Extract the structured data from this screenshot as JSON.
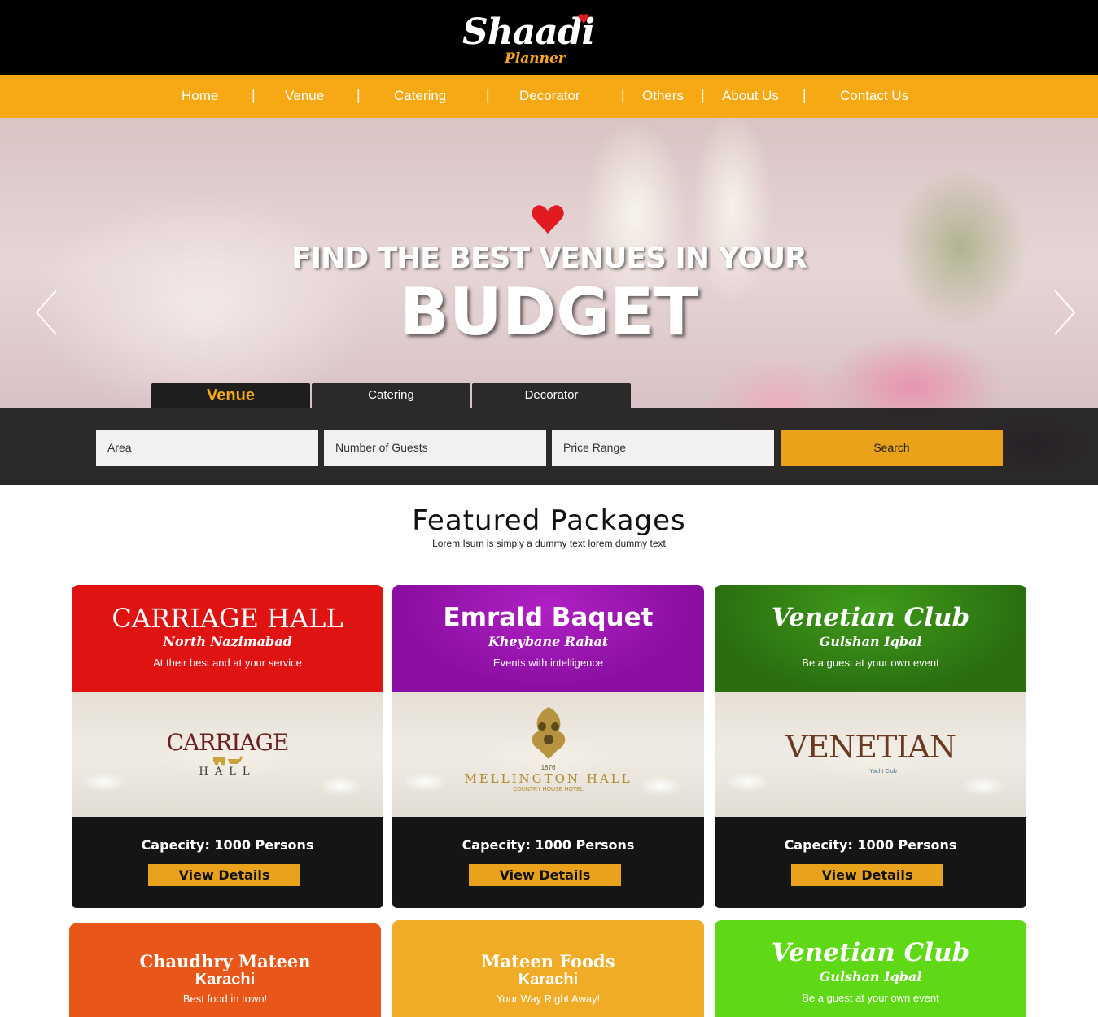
{
  "brand": {
    "name": "Shaadi",
    "sub": "Planner"
  },
  "nav": {
    "items": [
      "Home",
      "Venue",
      "Catering",
      "Decorator",
      "Others",
      "About Us",
      "Contact Us"
    ],
    "separator": "|"
  },
  "hero": {
    "line1": "FIND THE BEST VENUES IN YOUR",
    "line2": "BUDGET"
  },
  "search": {
    "tabs": [
      "Venue",
      "Catering",
      "Decorator"
    ],
    "active_tab": "Venue",
    "fields": [
      "Area",
      "Number of Guests",
      "Price Range"
    ],
    "button": "Search"
  },
  "featured": {
    "title": "Featured Packages",
    "subtitle": "Lorem Isum is simply a dummy text lorem dummy text"
  },
  "cards": [
    {
      "name": "CARRIAGE HALL",
      "area": "North Nazimabad",
      "tagline": "At their best and at your service",
      "logo_main": "CARRIAGE",
      "logo_sub": "HALL",
      "capacity": "Capecity: 1000 Persons",
      "button": "View Details",
      "color": "#e01313"
    },
    {
      "name": "Emrald Baquet",
      "area": "Kheybane Rahat",
      "tagline": "Events with intelligence",
      "logo_year": "1876",
      "logo_main": "MELLINGTON HALL",
      "logo_sub": "COUNTRY HOUSE HOTEL",
      "capacity": "Capecity: 1000 Persons",
      "button": "View Details",
      "color": "#8a0ea1"
    },
    {
      "name": "Venetian Club",
      "area": "Gulshan Iqbal",
      "tagline": "Be a guest at your own event",
      "logo_main": "VENETIAN",
      "logo_sub": "Yacht Club",
      "capacity": "Capecity: 1000 Persons",
      "button": "View Details",
      "color": "#2f7d12"
    },
    {
      "name": "Chaudhry Mateen",
      "area": "Karachi",
      "tagline": "Best food in town!",
      "color": "#e8561a"
    },
    {
      "name": "Mateen Foods",
      "area": "Karachi",
      "tagline": "Your Way Right Away!",
      "color": "#f0ac26"
    },
    {
      "name": "Venetian Club",
      "area": "Gulshan Iqbal",
      "tagline": "Be a guest at your own event",
      "color": "#5fd916"
    }
  ],
  "icons": {
    "heart": "heart-icon",
    "prev": "chevron-left-icon",
    "next": "chevron-right-icon"
  }
}
